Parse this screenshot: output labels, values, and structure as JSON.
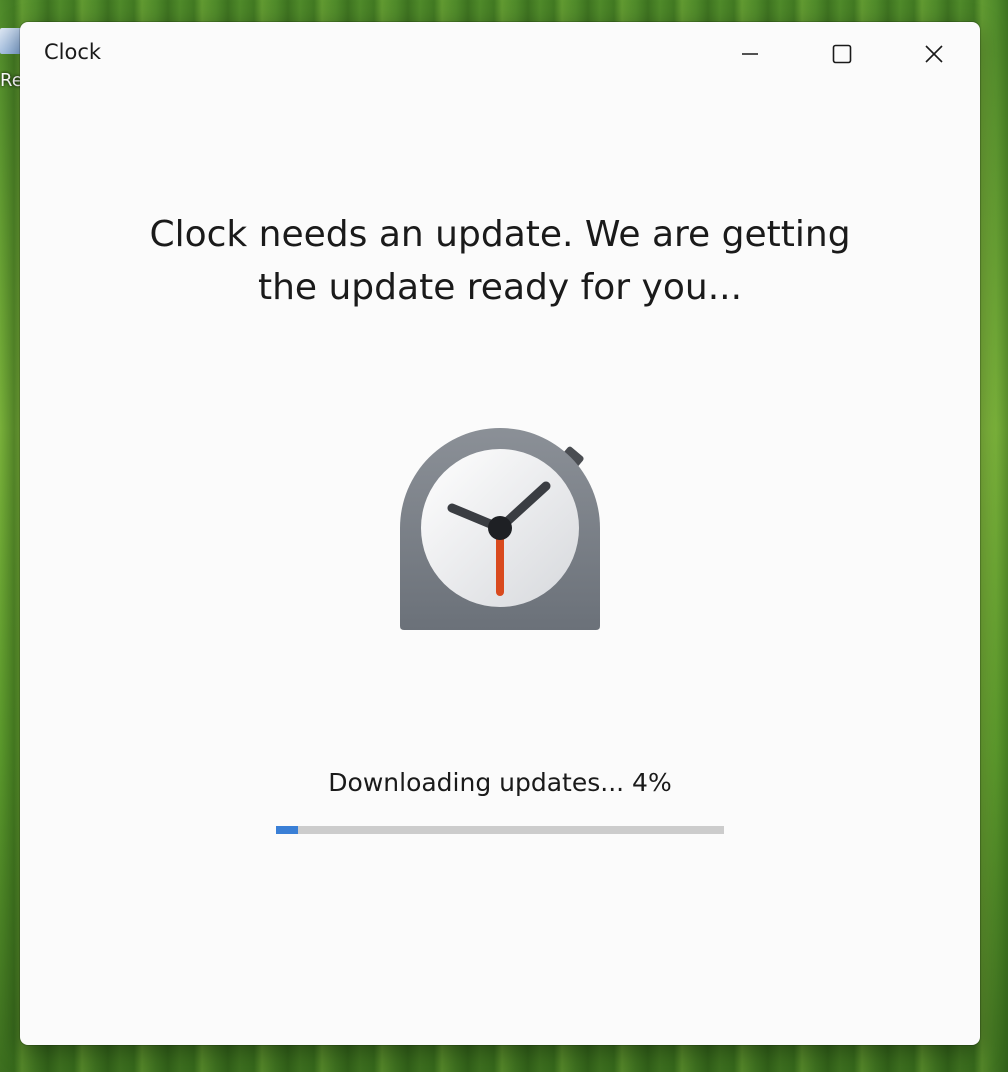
{
  "desktop": {
    "icon_label": "Recycle Bin"
  },
  "window": {
    "title": "Clock",
    "controls": {
      "minimize": "minimize-icon",
      "maximize": "maximize-icon",
      "close": "close-icon"
    }
  },
  "main": {
    "headline_line1": "Clock needs an update. We are getting",
    "headline_line2": "the update ready for you...",
    "app_icon": "clock-app-icon",
    "status_text": "Downloading updates... 4%",
    "progress_fraction": 0.05
  },
  "colors": {
    "accent": "#3a7fd6",
    "track": "#cccccc",
    "second_hand": "#d94a1e"
  }
}
